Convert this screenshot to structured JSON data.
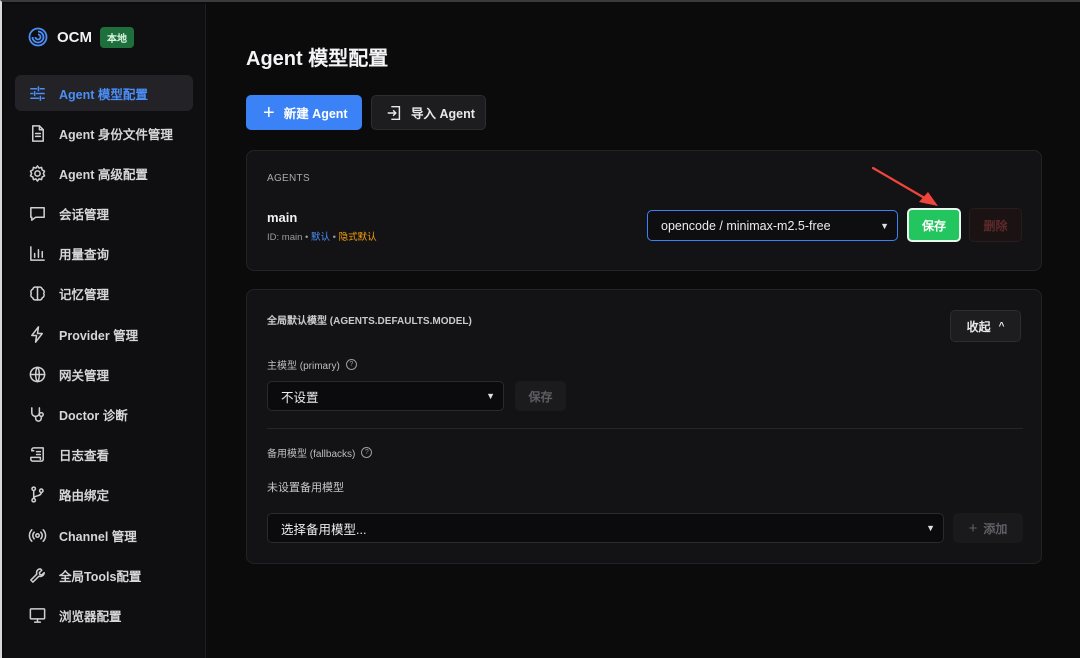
{
  "brand": {
    "name": "OCM",
    "badge": "本地"
  },
  "sidebar": {
    "items": [
      {
        "label": "Agent 模型配置",
        "icon": "sliders-icon",
        "active": true
      },
      {
        "label": "Agent 身份文件管理",
        "icon": "file-text-icon"
      },
      {
        "label": "Agent 高级配置",
        "icon": "gear-icon"
      },
      {
        "label": "会话管理",
        "icon": "chat-icon"
      },
      {
        "label": "用量查询",
        "icon": "bar-chart-icon"
      },
      {
        "label": "记忆管理",
        "icon": "brain-icon"
      },
      {
        "label": "Provider 管理",
        "icon": "bolt-icon"
      },
      {
        "label": "网关管理",
        "icon": "globe-icon"
      },
      {
        "label": "Doctor 诊断",
        "icon": "stethoscope-icon"
      },
      {
        "label": "日志查看",
        "icon": "scroll-icon"
      },
      {
        "label": "路由绑定",
        "icon": "git-branch-icon"
      },
      {
        "label": "Channel 管理",
        "icon": "radio-icon"
      },
      {
        "label": "全局Tools配置",
        "icon": "wrench-icon"
      },
      {
        "label": "浏览器配置",
        "icon": "monitor-icon"
      }
    ]
  },
  "main": {
    "title": "Agent 模型配置",
    "new_agent_label": "新建 Agent",
    "import_agent_label": "导入 Agent",
    "agents": {
      "section_label": "AGENTS",
      "agent": {
        "name": "main",
        "id_text": "ID: main",
        "sep1": " • ",
        "default_tag": "默认",
        "sep2": " • ",
        "implicit_default_tag": "隐式默认"
      },
      "model_select_value": "opencode / minimax-m2.5-free",
      "save_label": "保存",
      "delete_label": "删除"
    },
    "global": {
      "title": "全局默认模型 (AGENTS.DEFAULTS.MODEL)",
      "collapse_label": "收起",
      "primary_label": "主模型 (primary)",
      "primary_value": "不设置",
      "primary_save_label": "保存",
      "fallback_label": "备用模型 (fallbacks)",
      "no_fallback_text": "未设置备用模型",
      "fallback_select_value": "选择备用模型...",
      "add_label": "添加"
    }
  },
  "colors": {
    "accent": "#3b82f6",
    "save_green": "#22c55e",
    "badge_green": "#1e6f3c",
    "annotation_arrow": "#f0453a"
  }
}
